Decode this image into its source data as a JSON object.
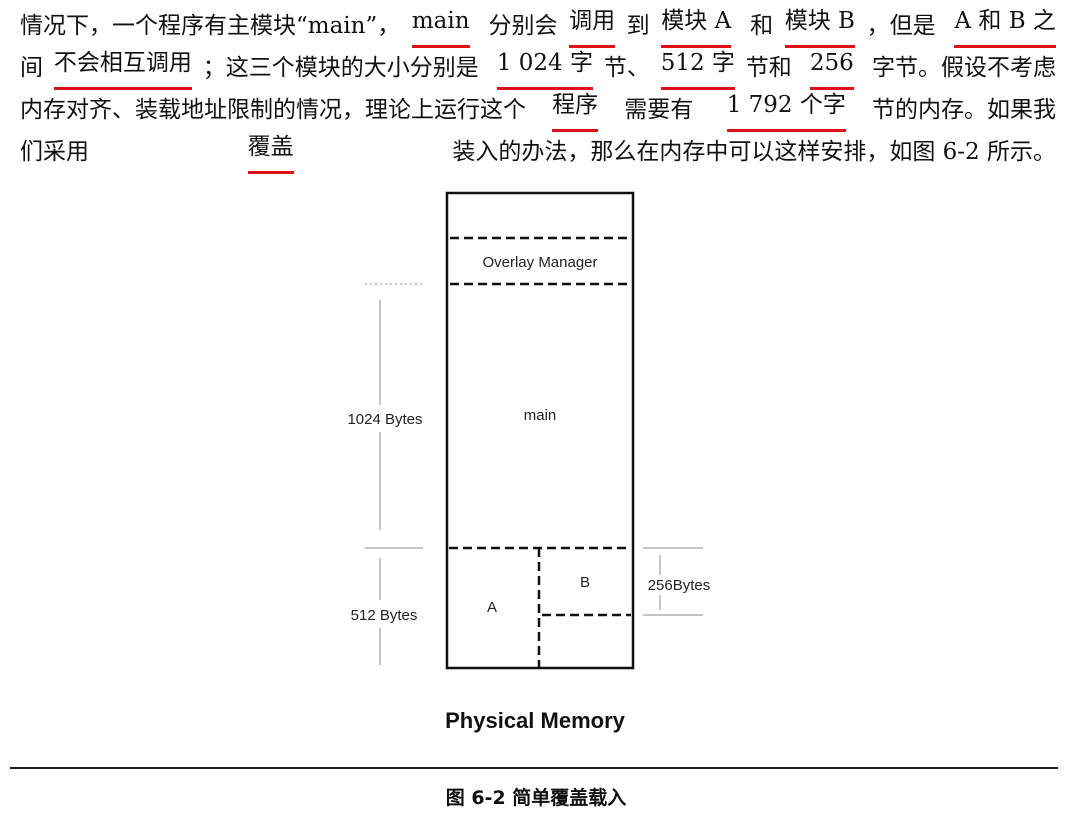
{
  "paragraph": {
    "lines": [
      [
        {
          "t": "情况下，一个程序有主模块“main”，"
        },
        {
          "t": "main",
          "u": true
        },
        {
          "t": " 分别会"
        },
        {
          "t": "调用",
          "u": true
        },
        {
          "t": "到"
        },
        {
          "t": "模块 A",
          "u": true
        },
        {
          "t": " 和"
        },
        {
          "t": "模块 B",
          "u": true
        },
        {
          "t": "，但是 "
        },
        {
          "t": "A 和 B 之",
          "u": true
        }
      ],
      [
        {
          "t": "间"
        },
        {
          "t": "不会相互调用",
          "u": true
        },
        {
          "t": "；这三个模块的大小分别是 "
        },
        {
          "t": "1 024 字",
          "u": true
        },
        {
          "t": "节、"
        },
        {
          "t": "512 字",
          "u": true
        },
        {
          "t": "节和 "
        },
        {
          "t": "256",
          "u": true
        },
        {
          "t": " 字节。假设不考虑"
        }
      ],
      [
        {
          "t": "内存对齐、装载地址限制的情况，理论上运行这个"
        },
        {
          "t": "程序",
          "u": true
        },
        {
          "t": "需要有 "
        },
        {
          "t": "1 792 个字",
          "u": true
        },
        {
          "t": "节的内存。如果我"
        }
      ],
      [
        {
          "t": "们采用"
        },
        {
          "t": "覆盖",
          "u": true
        },
        {
          "t": "装入的办法，那么在内存中可以这样安排，如图 6-2 所示。"
        }
      ]
    ],
    "underline_color": "#e0101a"
  },
  "diagram": {
    "overlay_manager": "Overlay Manager",
    "main": "main",
    "module_a": "A",
    "module_b": "B",
    "size_main": "1024 Bytes",
    "size_a": "512 Bytes",
    "size_b": "256Bytes",
    "title": "Physical Memory"
  },
  "caption": "图 6-2   简单覆盖载入"
}
